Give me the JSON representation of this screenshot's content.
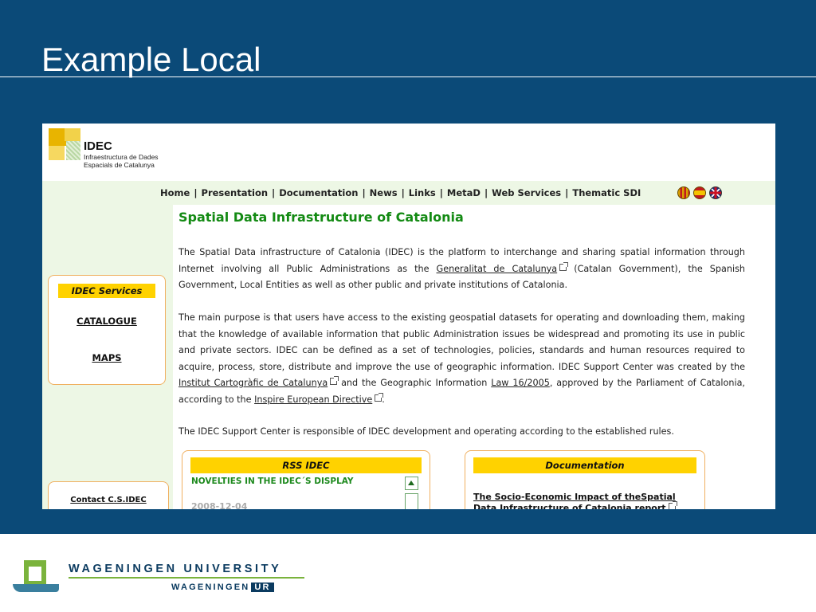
{
  "slide": {
    "title": "Example Local"
  },
  "site": {
    "logo": {
      "name": "IDEC",
      "subtitle_line1": "Infraestructura de Dades",
      "subtitle_line2": "Espacials de Catalunya"
    },
    "nav": [
      "Home",
      "Presentation",
      "Documentation",
      "News",
      "Links",
      "MetaD",
      "Web Services",
      "Thematic SDI"
    ],
    "languages": [
      "catalan-flag-icon",
      "spain-flag-icon",
      "uk-flag-icon"
    ],
    "sidebar": {
      "services_title": "IDEC Services",
      "links": [
        "CATALOGUE",
        "MAPS"
      ],
      "contact": "Contact C.S.IDEC"
    },
    "main": {
      "heading": "Spatial Data Infrastructure of Catalonia",
      "p1": {
        "before": "The Spatial Data infrastructure of Catalonia (IDEC) is the platform to interchange and sharing spatial information through Internet involving all Public Administrations as the ",
        "link": "Generalitat de Catalunya",
        "after": " (Catalan Government), the Spanish Government, Local Entities as well as other public and private institutions of Catalonia."
      },
      "p2": {
        "part1": "The main purpose is that users have access to the existing geospatial datasets for operating and downloading them, making that the knowledge of available information that public Administration issues be widespread and promoting its use in public and private sectors. IDEC can be defined as a set of technologies, policies, standards and human resources required to acquire, process, store, distribute and improve the use of geographic information. IDEC Support Center was created by the ",
        "link1": "Institut Cartogràfic de Catalunya",
        "part2": " and the Geographic Information ",
        "link2": "Law 16/2005",
        "part3": ", approved by the Parliament of Catalonia, according to the ",
        "link3": "Inspire European Directive",
        "part4": "."
      },
      "p3": "The IDEC Support Center is responsible of IDEC development and operating according to the established rules."
    },
    "rss": {
      "title": "RSS IDEC",
      "heading": "NOVELTIES IN THE IDEC´S DISPLAY",
      "date": "2008-12-04"
    },
    "documentation": {
      "title": "Documentation",
      "link_line1": "The Socio-Economic Impact of theSpatial",
      "link_line2": "Data Infrastructure of Catalonia report"
    }
  },
  "footer": {
    "university": "WAGENINGEN UNIVERSITY",
    "sub": "WAGENINGEN",
    "ur": "UR"
  }
}
